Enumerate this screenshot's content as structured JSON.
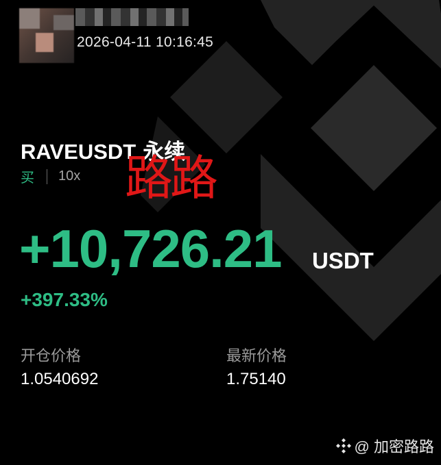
{
  "header": {
    "timestamp": "2026-04-11 10:16:45"
  },
  "position": {
    "symbol": "RAVEUSDT",
    "contract_type": "永续",
    "side": "买",
    "leverage": "10x",
    "pnl": "+10,726.21",
    "pnl_unit": "USDT",
    "roe": "+397.33%",
    "entry_price_label": "开仓价格",
    "entry_price": "1.0540692",
    "last_price_label": "最新价格",
    "last_price": "1.75140"
  },
  "overlay": {
    "red_text": "路路"
  },
  "footer": {
    "watermark": "@ 加密路路"
  },
  "colors": {
    "background": "#000000",
    "profit_green": "#2ebd85",
    "overlay_red": "#e01717",
    "label_gray": "#9a9a9a"
  },
  "icons": {
    "background_logo": "binance-logo-icon",
    "footer_logo": "diamond-logo-icon"
  }
}
